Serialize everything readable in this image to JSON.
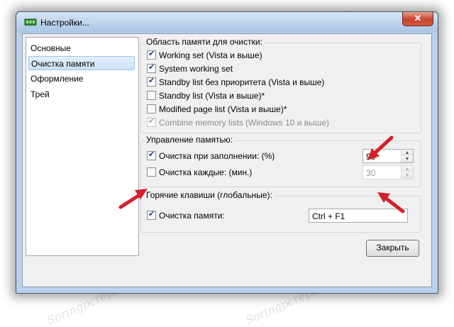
{
  "window": {
    "title": "Настройки...",
    "close_glyph": "✕"
  },
  "nav": {
    "items": [
      {
        "label": "Основные",
        "selected": false
      },
      {
        "label": "Очистка памяти",
        "selected": true
      },
      {
        "label": "Оформление",
        "selected": false
      },
      {
        "label": "Трей",
        "selected": false
      }
    ]
  },
  "memory_area": {
    "legend": "Область памяти для очистки:",
    "options": [
      {
        "label": "Working set (Vista и выше)",
        "checked": true,
        "disabled": false
      },
      {
        "label": "System working set",
        "checked": true,
        "disabled": false
      },
      {
        "label": "Standby list без приоритета (Vista и выше)",
        "checked": true,
        "disabled": false
      },
      {
        "label": "Standby list (Vista и выше)*",
        "checked": false,
        "disabled": false
      },
      {
        "label": "Modified page list (Vista и выше)*",
        "checked": false,
        "disabled": false
      },
      {
        "label": "Combine memory lists (Windows 10 и выше)",
        "checked": true,
        "disabled": true
      }
    ]
  },
  "memory_management": {
    "legend": "Управление памятью:",
    "fill_clean": {
      "label": "Очистка при заполнении: (%)",
      "checked": true,
      "value": "90"
    },
    "interval_clean": {
      "label": "Очистка каждые: (мин.)",
      "checked": false,
      "value": "30"
    }
  },
  "hotkeys": {
    "legend": "Горячие клавиши (глобальные):",
    "clean": {
      "label": "Очистка памяти:",
      "checked": true,
      "value": "Ctrl + F1"
    }
  },
  "footer": {
    "close_label": "Закрыть"
  },
  "watermark": "Soringpcrepair.Com",
  "colors": {
    "annotation_red": "#d4202a",
    "selection_bg": "#cbe2f7",
    "close_button_red": "#c7432c"
  }
}
